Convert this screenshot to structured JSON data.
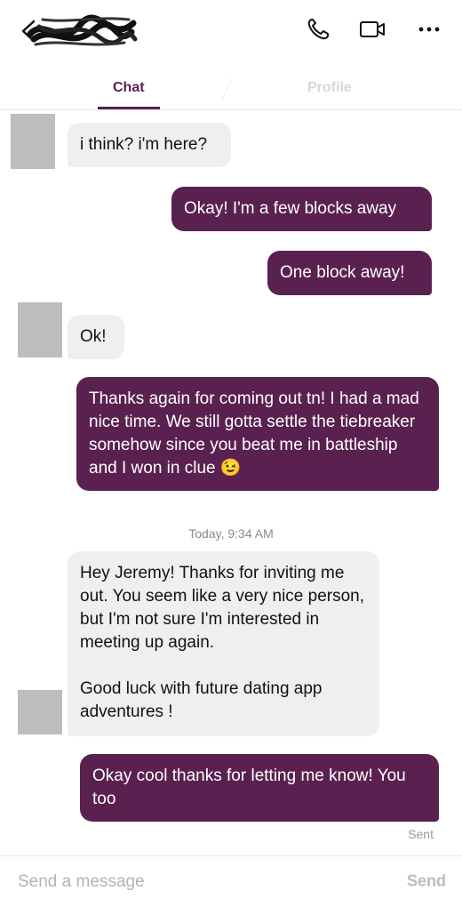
{
  "header": {
    "call_icon": "phone-icon",
    "video_icon": "video-camera-icon",
    "more_icon": "more-dots-icon"
  },
  "tabs": [
    {
      "label": "Chat",
      "active": true
    },
    {
      "label": "Profile",
      "active": false
    }
  ],
  "messages": [
    {
      "from": "them",
      "text": "i think? i'm here?"
    },
    {
      "from": "me",
      "text": "Okay! I'm a few blocks away"
    },
    {
      "from": "me",
      "text": "One block away!"
    },
    {
      "from": "them",
      "text": "Ok!"
    },
    {
      "from": "me",
      "text": "Thanks again for coming out tn! I had a mad nice time. We still gotta settle the tiebreaker somehow since you beat me in battleship and I won in clue 😉"
    },
    {
      "from": "them",
      "text": "Hey Jeremy! Thanks for inviting me out. You seem like a very nice person, but I'm not sure I'm interested in meeting up again.\n\nGood luck with future dating app adventures !"
    },
    {
      "from": "me",
      "text": "Okay cool thanks for letting me know! You too"
    }
  ],
  "timestamp": "Today, 9:34 AM",
  "status": "Sent",
  "composer": {
    "placeholder": "Send a message",
    "send_label": "Send"
  },
  "colors": {
    "accent": "#5a2150",
    "incoming_bubble": "#efefef"
  }
}
